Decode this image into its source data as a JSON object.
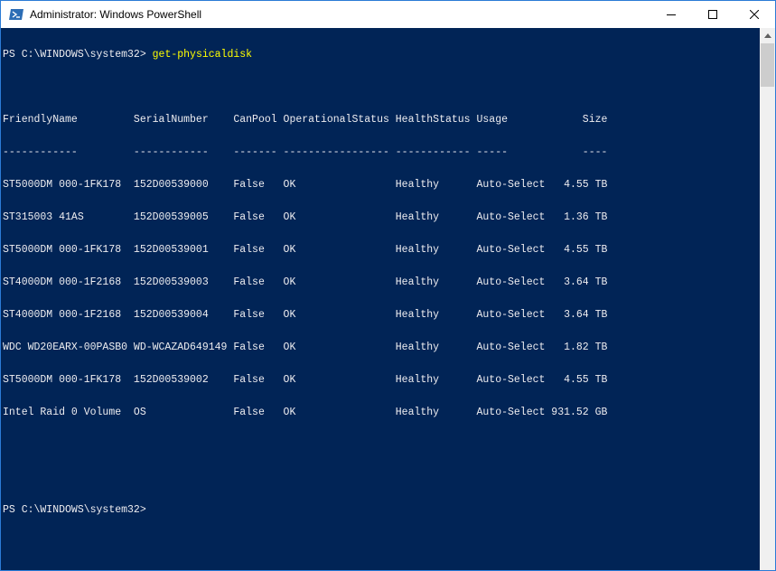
{
  "window": {
    "title": "Administrator: Windows PowerShell",
    "icon": "powershell-icon",
    "controls": [
      "minimize-icon",
      "maximize-icon",
      "close-icon"
    ]
  },
  "console": {
    "prompt1": "PS C:\\WINDOWS\\system32> ",
    "command": "get-physicaldisk",
    "blank1": "",
    "header": "FriendlyName         SerialNumber    CanPool OperationalStatus HealthStatus Usage            Size",
    "underline": "------------         ------------    ------- ----------------- ------------ -----            ----",
    "rows": [
      "ST5000DM 000-1FK178  152D00539000    False   OK                Healthy      Auto-Select   4.55 TB",
      "ST315003 41AS        152D00539005    False   OK                Healthy      Auto-Select   1.36 TB",
      "ST5000DM 000-1FK178  152D00539001    False   OK                Healthy      Auto-Select   4.55 TB",
      "ST4000DM 000-1F2168  152D00539003    False   OK                Healthy      Auto-Select   3.64 TB",
      "ST4000DM 000-1F2168  152D00539004    False   OK                Healthy      Auto-Select   3.64 TB",
      "WDC WD20EARX-00PASB0 WD-WCAZAD649149 False   OK                Healthy      Auto-Select   1.82 TB",
      "ST5000DM 000-1FK178  152D00539002    False   OK                Healthy      Auto-Select   4.55 TB",
      "Intel Raid 0 Volume  OS              False   OK                Healthy      Auto-Select 931.52 GB"
    ],
    "blank2": "",
    "blank3": "",
    "prompt2": "PS C:\\WINDOWS\\system32> "
  },
  "colors": {
    "console_bg": "#012456",
    "console_text": "#eeedf0",
    "command_text": "#ffff00",
    "window_border": "#2b7bd6"
  }
}
